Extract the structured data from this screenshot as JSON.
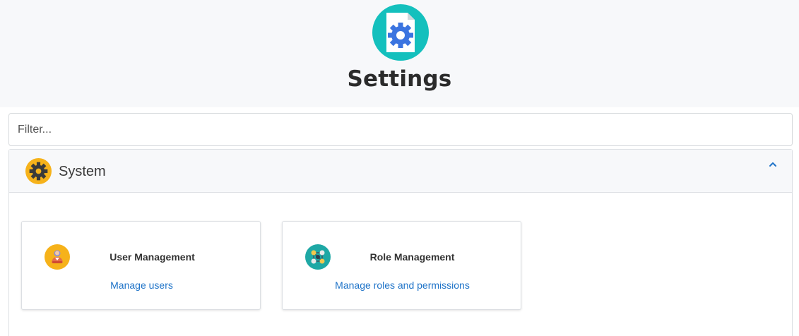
{
  "header": {
    "title": "Settings",
    "logo_icon": "settings-file-gear-icon"
  },
  "filter": {
    "placeholder": "Filter...",
    "value": ""
  },
  "sections": [
    {
      "title": "System",
      "icon": "gear-icon",
      "expanded": true,
      "toggle_icon": "chevron-up-icon",
      "cards": [
        {
          "title": "User Management",
          "link": "Manage users",
          "icon": "user-icon"
        },
        {
          "title": "Role Management",
          "link": "Manage roles and permissions",
          "icon": "roles-network-icon"
        }
      ]
    }
  ],
  "colors": {
    "header_bg": "#f7f8fa",
    "logo_circle": "#14c0bd",
    "gear_blue": "#3b74e0",
    "link": "#1e73c8",
    "system_icon_bg": "#f6b21a"
  }
}
